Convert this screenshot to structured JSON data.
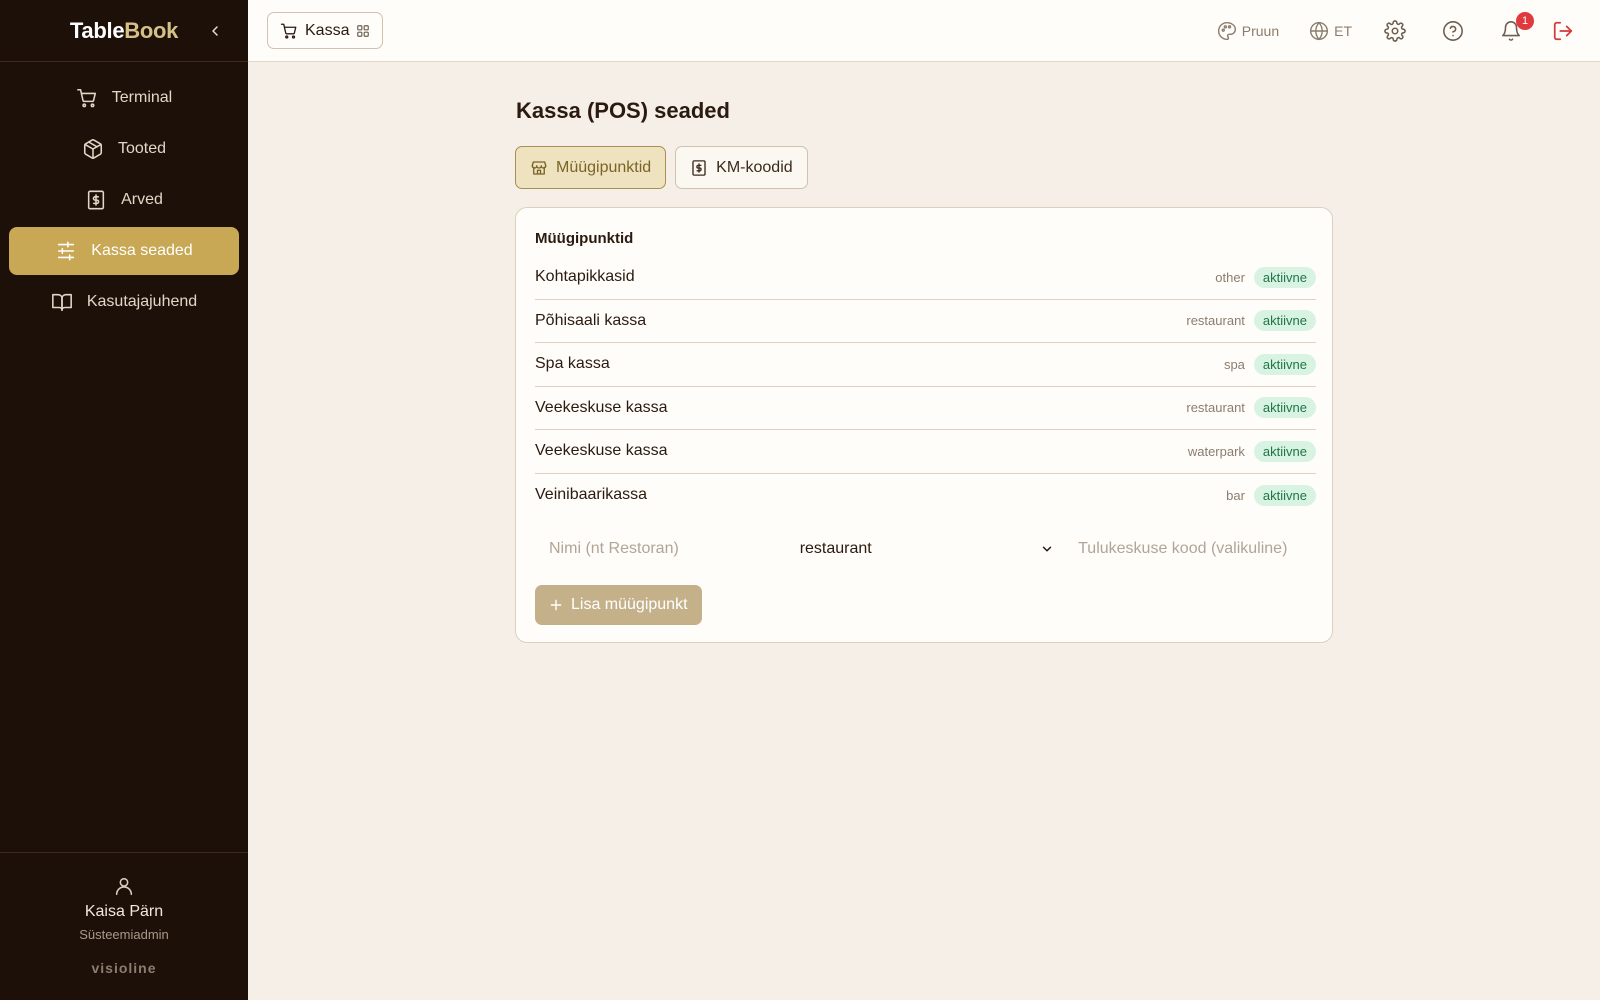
{
  "brand": {
    "part1": "Table",
    "part2": "Book"
  },
  "sidebar": {
    "items": [
      {
        "label": "Terminal",
        "icon": "cart-icon"
      },
      {
        "label": "Tooted",
        "icon": "box-icon"
      },
      {
        "label": "Arved",
        "icon": "invoice-icon"
      },
      {
        "label": "Kassa seaded",
        "icon": "sliders-icon",
        "active": true
      },
      {
        "label": "Kasutajajuhend",
        "icon": "book-icon"
      }
    ],
    "user": {
      "name": "Kaisa Pärn",
      "role": "Süsteemiadmin"
    },
    "vendor": "visioline"
  },
  "topbar": {
    "module_label": "Kassa",
    "theme_label": "Pruun",
    "lang_label": "ET",
    "notifications_count": "1"
  },
  "page": {
    "title": "Kassa (POS) seaded",
    "tabs": [
      {
        "label": "Müügipunktid",
        "active": true
      },
      {
        "label": "KM-koodid",
        "active": false
      }
    ]
  },
  "card": {
    "title": "Müügipunktid",
    "rows": [
      {
        "name": "Kohtapikkasid",
        "type": "other",
        "status": "aktiivne"
      },
      {
        "name": "Põhisaali kassa",
        "type": "restaurant",
        "status": "aktiivne"
      },
      {
        "name": "Spa kassa",
        "type": "spa",
        "status": "aktiivne"
      },
      {
        "name": "Veekeskuse kassa",
        "type": "restaurant",
        "status": "aktiivne"
      },
      {
        "name": "Veekeskuse kassa",
        "type": "waterpark",
        "status": "aktiivne"
      },
      {
        "name": "Veinibaarikassa",
        "type": "bar",
        "status": "aktiivne"
      }
    ],
    "form": {
      "name_placeholder": "Nimi (nt Restoran)",
      "type_selected": "restaurant",
      "code_placeholder": "Tulukeskuse kood (valikuline)",
      "add_label": "Lisa müügipunkt"
    }
  },
  "colors": {
    "sidebar_bg": "#1d1009",
    "accent": "#c8a755",
    "status_bg": "#d8f3e2",
    "status_text": "#217548",
    "logout": "#d33a3a"
  }
}
